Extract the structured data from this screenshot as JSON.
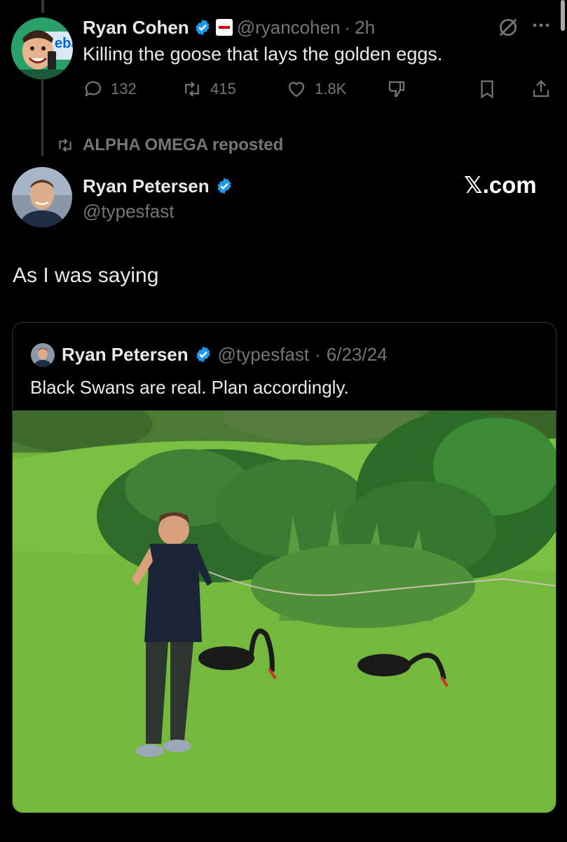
{
  "colors": {
    "background": "#000000",
    "text": "#e7e9ea",
    "muted": "#71767b",
    "verified": "#1d9bf0"
  },
  "first_tweet": {
    "author_name": "Ryan Cohen",
    "handle": "@ryancohen",
    "separator": "·",
    "time": "2h",
    "text": "Killing the goose that lays the golden eggs.",
    "avatar_badge_text": "eba",
    "actions": {
      "replies": "132",
      "reposts": "415",
      "likes": "1.8K"
    }
  },
  "repost_banner": {
    "text": "ALPHA OMEGA reposted"
  },
  "main_tweet": {
    "author_name": "Ryan Petersen",
    "handle": "@typesfast",
    "source_logo": "𝕏.com",
    "text": "As I was saying"
  },
  "quoted_tweet": {
    "author_name": "Ryan Petersen",
    "handle": "@typesfast",
    "separator": "·",
    "date": "6/23/24",
    "text": "Black Swans are real. Plan accordingly."
  },
  "icons": [
    "reply-icon",
    "repost-icon",
    "like-icon",
    "grok-icon",
    "bookmark-icon",
    "share-icon",
    "more-icon",
    "verified-icon",
    "repost-small-icon"
  ]
}
